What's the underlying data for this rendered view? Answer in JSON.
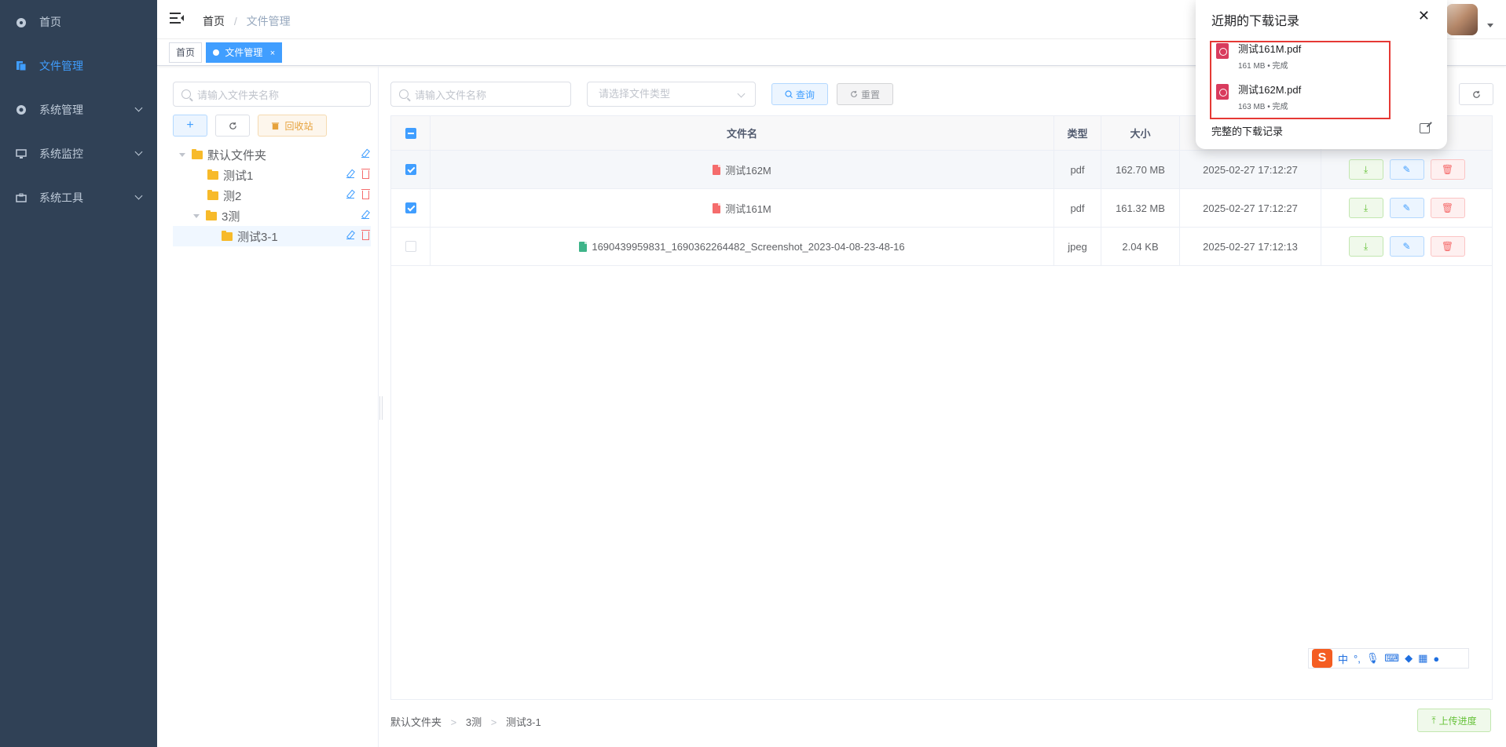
{
  "sidebar": {
    "items": [
      {
        "label": "首页",
        "icon": "dashboard-icon"
      },
      {
        "label": "文件管理",
        "icon": "file-icon",
        "active": true
      },
      {
        "label": "系统管理",
        "icon": "gear-icon"
      },
      {
        "label": "系统监控",
        "icon": "monitor-icon"
      },
      {
        "label": "系统工具",
        "icon": "toolbox-icon"
      }
    ]
  },
  "navbar": {
    "breadcrumb": [
      "首页",
      "文件管理"
    ],
    "breadcrumb_sep": "/"
  },
  "tags": [
    {
      "label": "首页"
    },
    {
      "label": "文件管理",
      "close": "×",
      "active": true
    }
  ],
  "left": {
    "search_placeholder": "请输入文件夹名称",
    "recycle_label": "回收站",
    "tree": [
      {
        "label": "默认文件夹",
        "level": 0,
        "expanded": true
      },
      {
        "label": "测试1",
        "level": 1
      },
      {
        "label": "测2",
        "level": 1
      },
      {
        "label": "3测",
        "level": 1,
        "expanded": true
      },
      {
        "label": "测试3-1",
        "level": 2,
        "current": true
      }
    ]
  },
  "right": {
    "search_placeholder": "请输入文件名称",
    "type_placeholder": "请选择文件类型",
    "query_label": "查询",
    "reset_label": "重置",
    "columns": [
      "文件名",
      "类型",
      "大小"
    ],
    "rows": [
      {
        "name": "测试162M",
        "type": "pdf",
        "size": "162.70 MB",
        "date": "2025-02-27 17:12:27",
        "checked": true,
        "icon": "pdf"
      },
      {
        "name": "测试161M",
        "type": "pdf",
        "size": "161.32 MB",
        "date": "2025-02-27 17:12:27",
        "checked": true,
        "icon": "pdf"
      },
      {
        "name": "1690439959831_1690362264482_Screenshot_2023-04-08-23-48-16",
        "type": "jpeg",
        "size": "2.04 KB",
        "date": "2025-02-27 17:12:13",
        "checked": false,
        "icon": "img"
      }
    ],
    "path": [
      "默认文件夹",
      "3测",
      "测试3-1"
    ],
    "path_sep": ">",
    "upload_label": "上传进度"
  },
  "download_popup": {
    "title": "近期的下载记录",
    "items": [
      {
        "name": "测试161M.pdf",
        "meta": "161 MB • 完成"
      },
      {
        "name": "测试162M.pdf",
        "meta": "163 MB • 完成"
      }
    ],
    "footer": "完整的下载记录"
  },
  "ime": {
    "logo": "S",
    "mode": "中"
  },
  "colors": {
    "sidebar_bg": "#304156",
    "accent": "#409eff",
    "highlight_border": "#e53935"
  }
}
